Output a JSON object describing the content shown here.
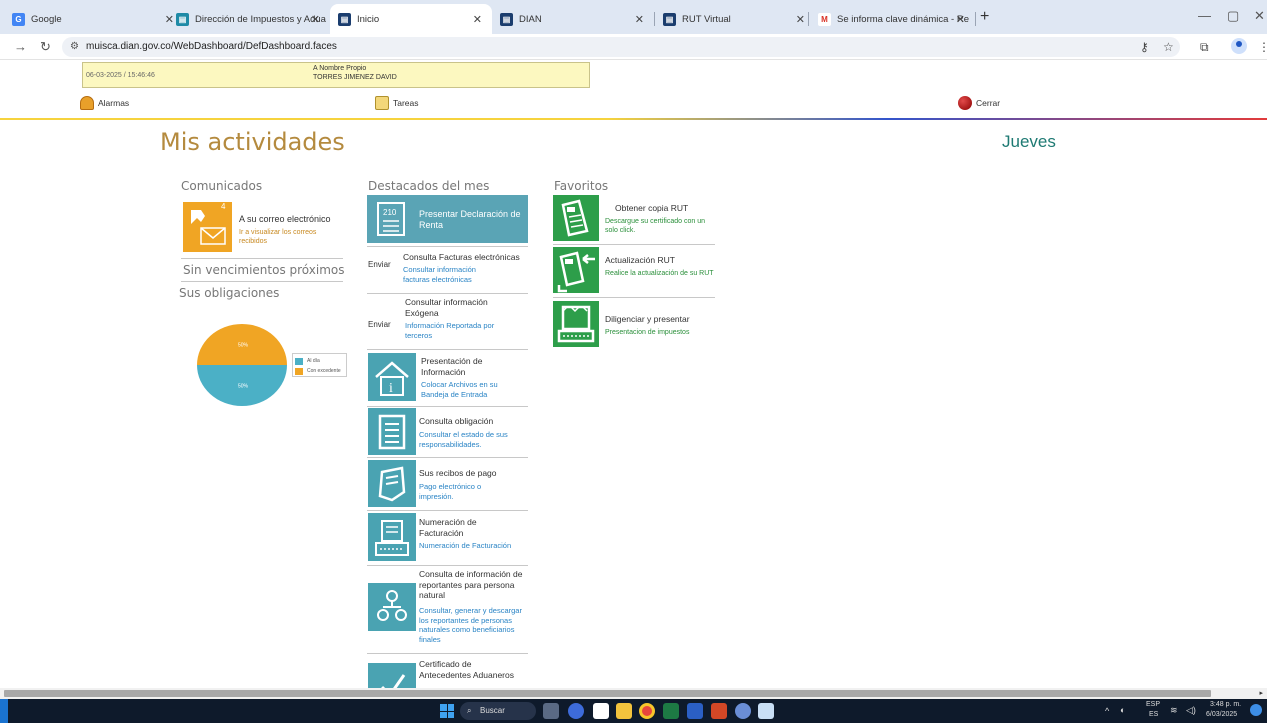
{
  "browser": {
    "tabs": [
      {
        "label": "Google",
        "color": "#4285f4",
        "glyph": "G"
      },
      {
        "label": "Dirección de Impuestos y Adua",
        "color": "#1e8aa6",
        "glyph": "▤"
      },
      {
        "label": "Inicio",
        "color": "#1b3d6e",
        "glyph": "▤"
      },
      {
        "label": "DIAN",
        "color": "#1b3d6e",
        "glyph": "▤"
      },
      {
        "label": "RUT Virtual",
        "color": "#1b3d6e",
        "glyph": "▤"
      },
      {
        "label": "Se informa clave dinámica - Re",
        "color": "#d93025",
        "glyph": "M"
      }
    ],
    "url": "muisca.dian.gov.co/WebDashboard/DefDashboard.faces"
  },
  "infobar": {
    "date": "06-03-2025 / 15:46:46",
    "mode": "A Nombre Propio",
    "user": "TORRES JIMENEZ DAVID"
  },
  "topnav": {
    "alarmas": "Alarmas",
    "tareas": "Tareas",
    "cerrar": "Cerrar"
  },
  "page": {
    "title": "Mis actividades",
    "day": "Jueves"
  },
  "comunicados": {
    "heading": "Comunicados",
    "count": "4",
    "mail_title": "A su correo electrónico",
    "mail_sub": "Ir a visualizar los correos recibidos",
    "no_due": "Sin vencimientos próximos",
    "obligations": "Sus obligaciones"
  },
  "chart_data": {
    "type": "pie",
    "categories": [
      "Al día",
      "Con excedente"
    ],
    "values": [
      50,
      50
    ],
    "colors": [
      "#4bb0c6",
      "#f0a524"
    ],
    "slice_labels": [
      "50%",
      "50%"
    ],
    "legend": "right"
  },
  "destacados": {
    "heading": "Destacados del mes",
    "hero": "Presentar Declaración de Renta",
    "hero_icon": "210",
    "items": [
      {
        "title": "Consulta Facturas electrónicas",
        "sub": "Consultar información facturas electrónicas",
        "broken": "Enviar"
      },
      {
        "title": "Consultar información Exógena",
        "sub": "Información Reportada por terceros",
        "broken": "Enviar"
      },
      {
        "title": "Presentación de Información",
        "sub": "Colocar Archivos en su Bandeja de Entrada"
      },
      {
        "title": "Consulta obligación",
        "sub": "Consultar el estado de sus responsabilidades."
      },
      {
        "title": "Sus recibos de pago",
        "sub": "Pago electrónico o impresión."
      },
      {
        "title": "Numeración de Facturación",
        "sub": "Numeración de Facturación"
      },
      {
        "title": "Consulta de información de reportantes para persona natural",
        "sub": "Consultar, generar y descargar los reportantes de personas naturales como beneficiarios finales"
      },
      {
        "title": "Certificado de Antecedentes Aduaneros",
        "sub": ""
      }
    ]
  },
  "favoritos": {
    "heading": "Favoritos",
    "items": [
      {
        "title": "Obtener copia RUT",
        "sub": "Descargue su certificado con un solo click."
      },
      {
        "title": "Actualización RUT",
        "sub": "Realice la actualización de su RUT"
      },
      {
        "title": "Diligenciar y presentar",
        "sub": "Presentacion de impuestos"
      }
    ]
  },
  "taskbar": {
    "search": "Buscar",
    "lang1": "ESP",
    "lang2": "ES",
    "time": "3:48 p. m.",
    "date": "6/03/2025"
  }
}
